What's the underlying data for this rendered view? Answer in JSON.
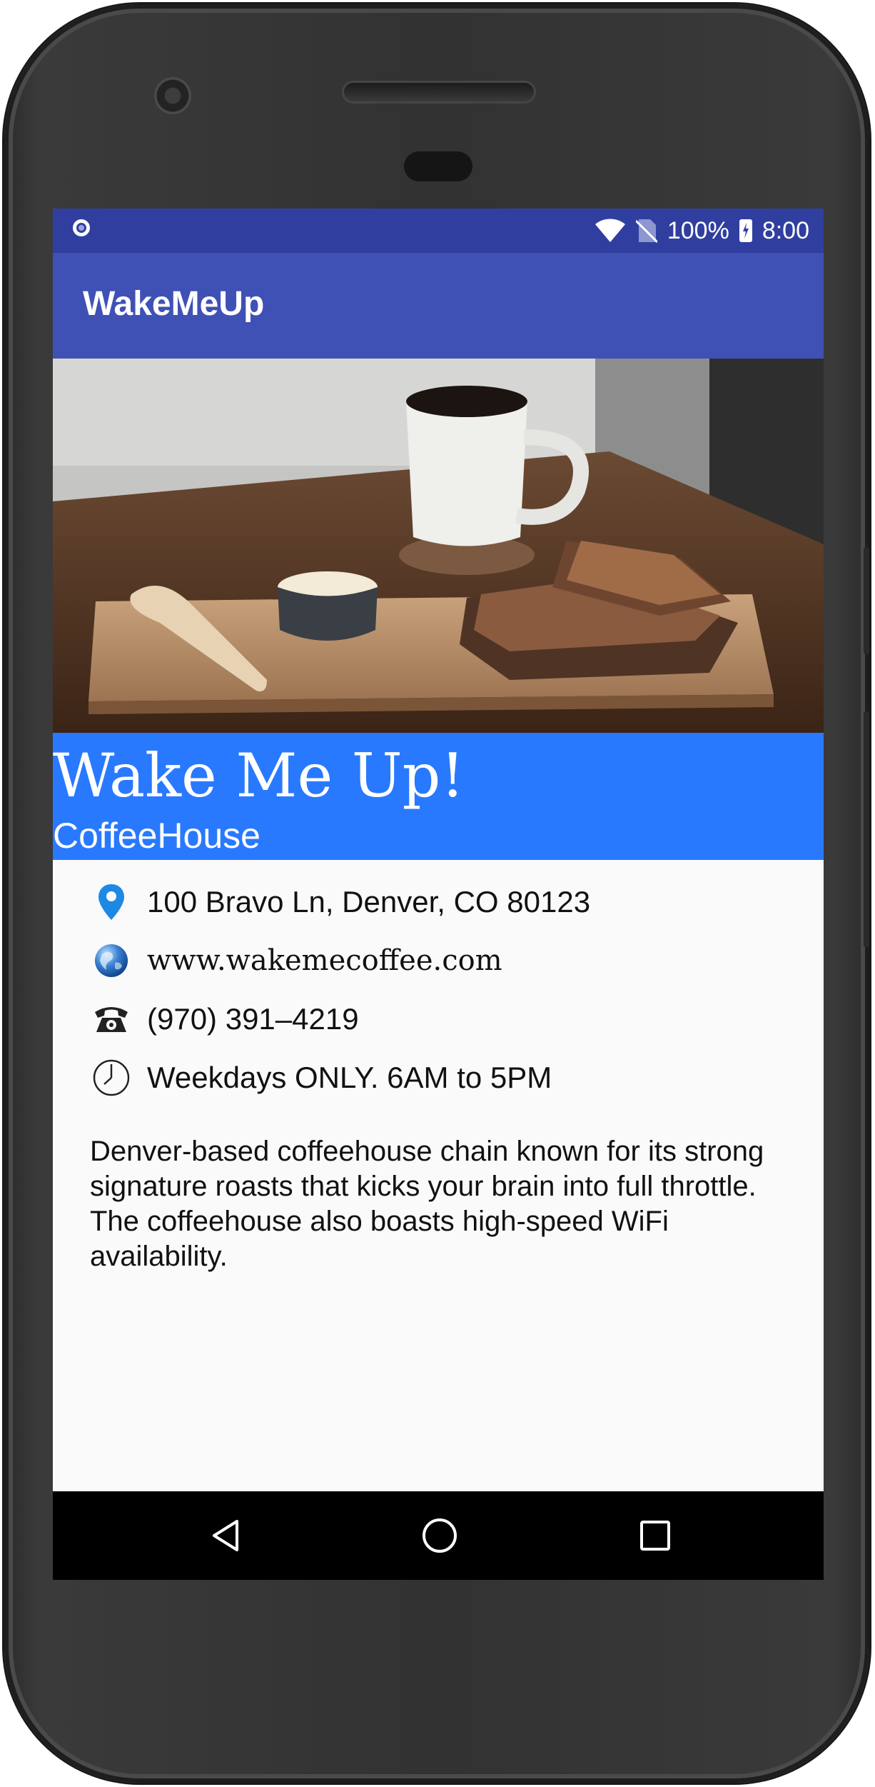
{
  "status_bar": {
    "battery": "100%",
    "time": "8:00"
  },
  "app_bar": {
    "title": "WakeMeUp"
  },
  "place": {
    "name": "Wake Me Up!",
    "category": "CoffeeHouse",
    "address": "100 Bravo Ln, Denver, CO 80123",
    "website": "www.wakemecoffee.com",
    "phone": "(970) 391–4219",
    "hours": "Weekdays ONLY. 6AM to 5PM",
    "description": "Denver-based coffeehouse chain known for its strong signature roasts that kicks your brain into full throttle. The coffeehouse also boasts high-speed WiFi availability."
  },
  "icons": {
    "status": [
      "notification-circle-icon",
      "wifi-icon",
      "no-sim-icon",
      "battery-charging-icon"
    ],
    "info": [
      "location-pin-icon",
      "globe-icon",
      "telephone-icon",
      "clock-icon"
    ],
    "nav": [
      "back-icon",
      "home-icon",
      "recents-icon"
    ]
  },
  "colors": {
    "status_bar": "#303f9f",
    "app_bar": "#3f51b5",
    "header": "#2979ff",
    "pin": "#1e88e5"
  }
}
